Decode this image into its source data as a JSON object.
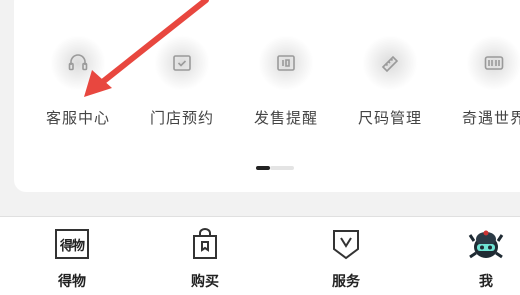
{
  "services": [
    {
      "label": "客服中心",
      "icon": "headset-icon"
    },
    {
      "label": "门店预约",
      "icon": "calendar-check-icon"
    },
    {
      "label": "发售提醒",
      "icon": "release-calendar-icon"
    },
    {
      "label": "尺码管理",
      "icon": "ruler-icon"
    },
    {
      "label": "奇遇世界",
      "icon": "world-icon"
    }
  ],
  "pager": {
    "pages": 2,
    "current": 1
  },
  "tabs": [
    {
      "label": "得物",
      "icon": "dewu-logo-icon",
      "icon_text": "得物"
    },
    {
      "label": "购买",
      "icon": "shopping-bag-icon"
    },
    {
      "label": "服务",
      "icon": "service-shield-icon"
    },
    {
      "label": "我",
      "icon": "avatar-icon"
    }
  ],
  "colors": {
    "annotation_arrow": "#e8473f",
    "background": "#f2f2f2",
    "card": "#ffffff"
  }
}
